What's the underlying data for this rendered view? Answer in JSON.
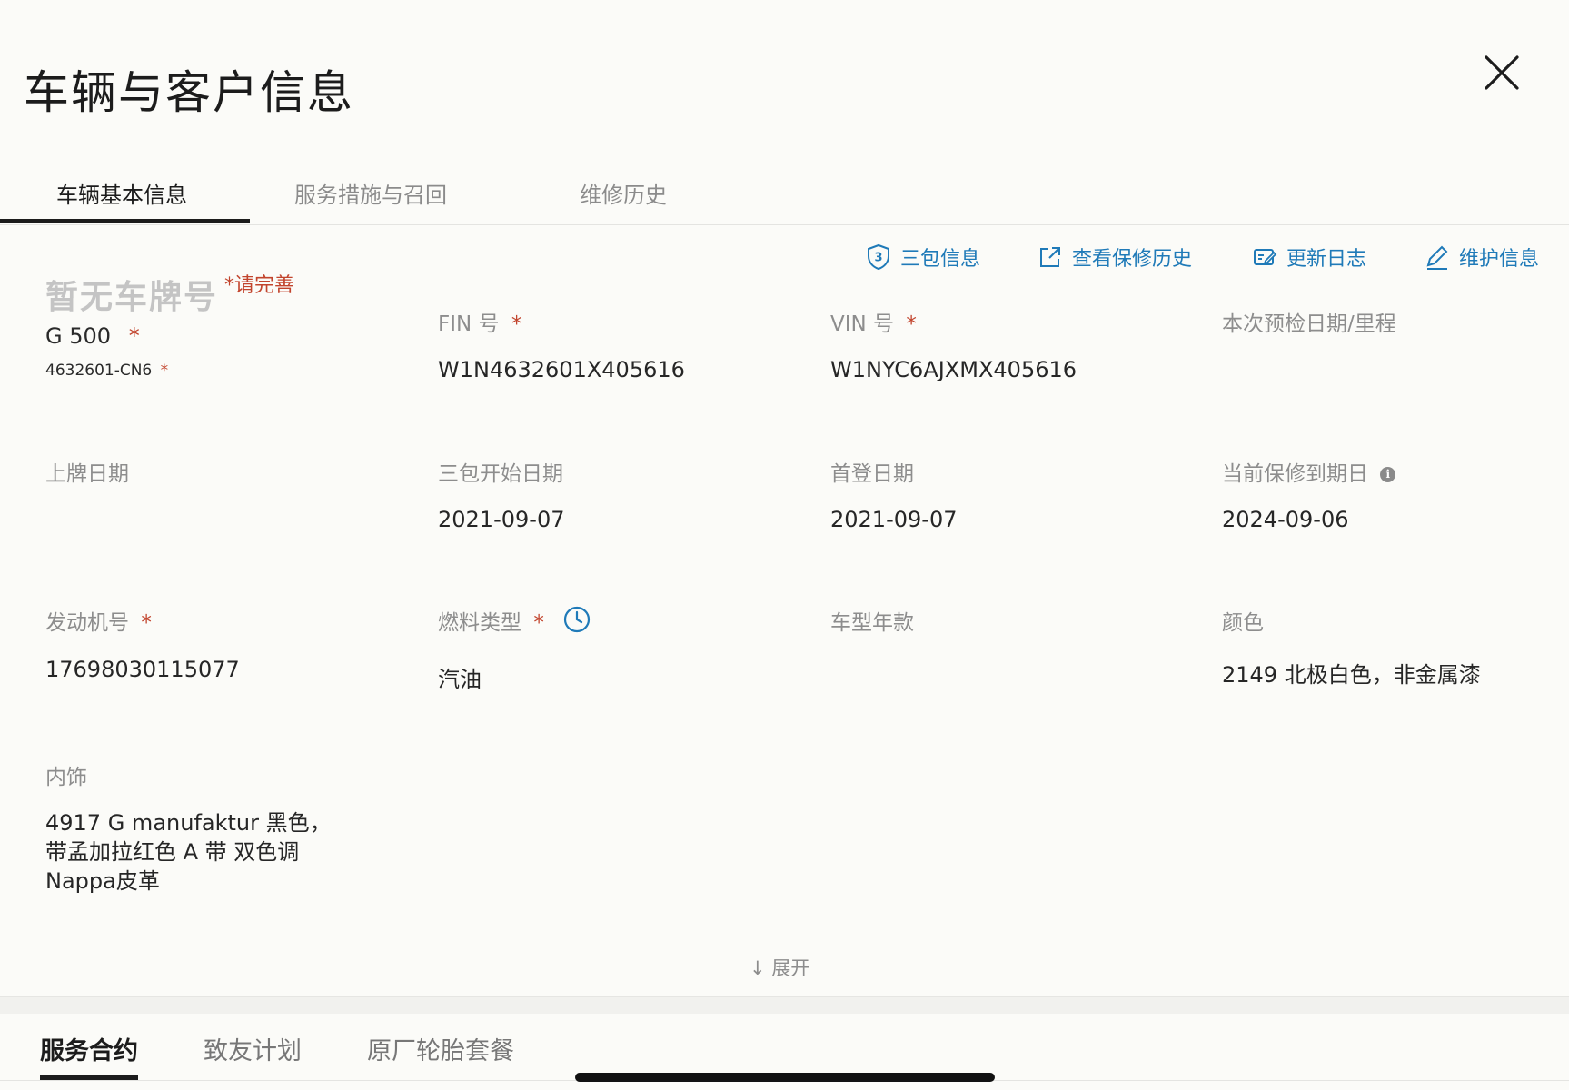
{
  "header": {
    "title": "车辆与客户信息",
    "close_icon": "close-icon"
  },
  "tabs": [
    {
      "label": "车辆基本信息",
      "active": true
    },
    {
      "label": "服务措施与召回",
      "active": false
    },
    {
      "label": "维修历史",
      "active": false
    }
  ],
  "actions": [
    {
      "label": "三包信息",
      "icon": "shield-3-icon"
    },
    {
      "label": "查看保修历史",
      "icon": "external-link-icon"
    },
    {
      "label": "更新日志",
      "icon": "edit-log-icon"
    },
    {
      "label": "维护信息",
      "icon": "pencil-icon"
    }
  ],
  "vehicle": {
    "plate": "暂无车牌号",
    "plate_required": "*请完善",
    "model": "G 500",
    "model_code": "4632601-CN6",
    "required_mark": "*"
  },
  "fields": {
    "fin": {
      "label": "FIN 号",
      "value": "W1N4632601X405616"
    },
    "vin": {
      "label": "VIN 号",
      "value": "W1NYC6AJXMX405616"
    },
    "inspection": {
      "label": "本次预检日期/里程",
      "value": ""
    },
    "registration_date": {
      "label": "上牌日期",
      "value": ""
    },
    "warranty_start": {
      "label": "三包开始日期",
      "value": "2021-09-07"
    },
    "first_registration": {
      "label": "首登日期",
      "value": "2021-09-07"
    },
    "warranty_end": {
      "label": "当前保修到期日",
      "value": "2024-09-06",
      "info": "i"
    },
    "engine_no": {
      "label": "发动机号",
      "value": "17698030115077"
    },
    "fuel_type": {
      "label": "燃料类型",
      "value": "汽油"
    },
    "model_year": {
      "label": "车型年款",
      "value": ""
    },
    "color": {
      "label": "颜色",
      "value": "2149 北极白色，非金属漆"
    },
    "interior": {
      "label": "内饰",
      "value": "4917 G manufaktur 黑色，带孟加拉红色 A 带 双色调Nappa皮革"
    }
  },
  "expand": {
    "label": "↓ 展开"
  },
  "bottom_tabs": [
    {
      "label": "服务合约",
      "active": true
    },
    {
      "label": "致友计划",
      "active": false
    },
    {
      "label": "原厂轮胎套餐",
      "active": false
    }
  ],
  "colors": {
    "accent": "#1f7ab8",
    "required": "#c2442d",
    "label": "#8d8d8d",
    "text": "#262626"
  }
}
